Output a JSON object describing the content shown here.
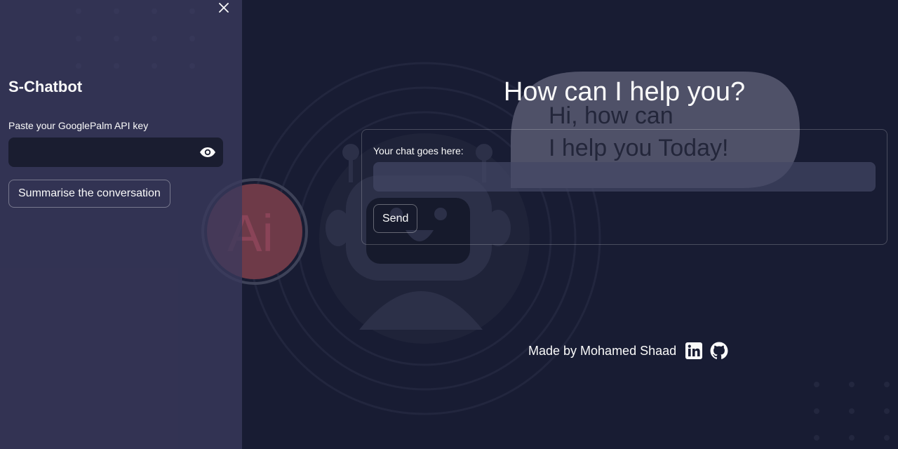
{
  "sidebar": {
    "title": "S-Chatbot",
    "api_key_label": "Paste your GooglePalm API key",
    "api_key_value": "",
    "summarise_button": "Summarise the conversation"
  },
  "main": {
    "title": "How can I help you?",
    "chat_label": "Your chat goes here:",
    "chat_value": "",
    "send_button": "Send"
  },
  "footer": {
    "made_by": "Made by Mohamed Shaad",
    "icons": [
      "linkedin-icon",
      "github-icon"
    ]
  },
  "background": {
    "bubble_line1": "Hi, how can",
    "bubble_line2": "I help you Today!",
    "badge_text": "Ai"
  },
  "colors": {
    "page_bg": "#181c33",
    "sidebar_bg": "#3a3a5c",
    "text": "#fafafa",
    "badge": "#b3262e"
  }
}
